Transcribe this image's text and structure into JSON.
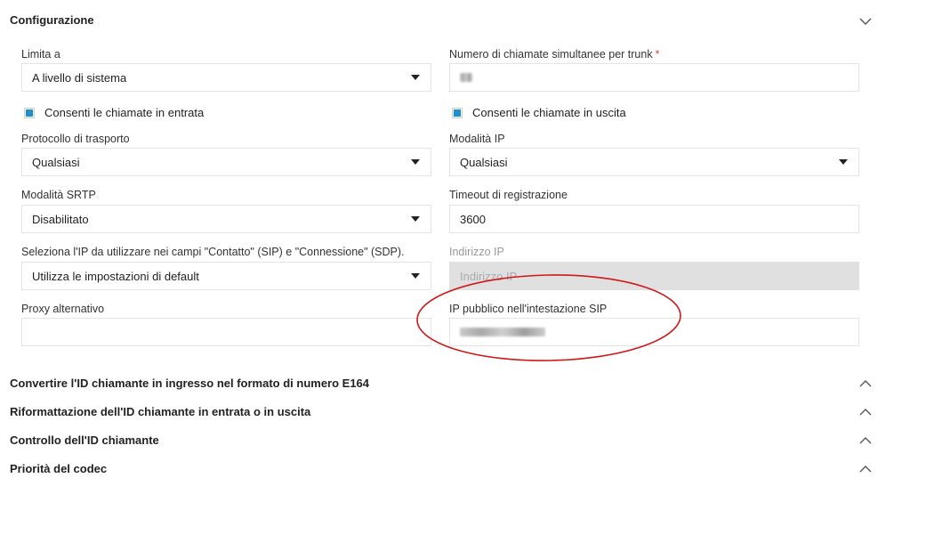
{
  "sections": {
    "config": "Configurazione",
    "e164": "Convertire l'ID chiamante in ingresso nel formato di numero E164",
    "reformat": "Riformattazione dell'ID chiamante in entrata o in uscita",
    "callerid": "Controllo dell'ID chiamante",
    "codec": "Priorità del codec"
  },
  "form": {
    "limit_label": "Limita a",
    "limit_value": "A livello di sistema",
    "simul_label": "Numero di chiamate simultanee per trunk",
    "required_mark": "*",
    "allow_in": "Consenti le chiamate in entrata",
    "allow_out": "Consenti le chiamate in uscita",
    "transport_label": "Protocollo di trasporto",
    "transport_value": "Qualsiasi",
    "ipmode_label": "Modalità IP",
    "ipmode_value": "Qualsiasi",
    "srtp_label": "Modalità SRTP",
    "srtp_value": "Disabilitato",
    "regtimeout_label": "Timeout di registrazione",
    "regtimeout_value": "3600",
    "selectip_label": "Seleziona l'IP da utilizzare nei campi \"Contatto\" (SIP) e \"Connessione\" (SDP).",
    "selectip_value": "Utilizza le impostazioni di default",
    "ipaddr_label": "Indirizzo IP",
    "ipaddr_placeholder": "Indirizzo IP",
    "proxy_label": "Proxy alternativo",
    "publicip_label": "IP pubblico nell'intestazione SIP"
  },
  "colors": {
    "checkbox": "#1a8fd1",
    "annotation": "#d01818",
    "required": "#e53935"
  },
  "icons": {
    "collapse": "chevron-down-icon",
    "expand": "chevron-up-icon",
    "dropdown": "caret-down-icon"
  }
}
